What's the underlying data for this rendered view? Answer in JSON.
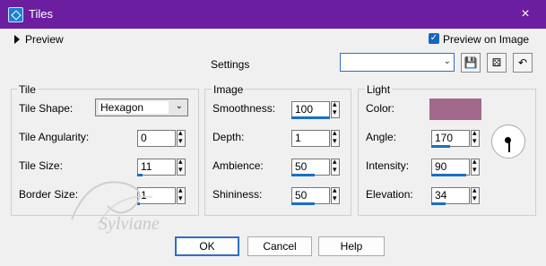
{
  "window": {
    "title": "Tiles",
    "close_glyph": "×"
  },
  "preview": {
    "label": "Preview",
    "checkbox_label": "Preview on Image",
    "checked": true
  },
  "settings": {
    "label": "Settings",
    "value": ""
  },
  "icons": [
    "app-icon",
    "expand-triangle-icon",
    "checkbox-check-icon",
    "dropdown-chevron-icon",
    "save-icon",
    "randomize-icon",
    "reset-icon"
  ],
  "tile": {
    "title": "Tile",
    "shape_label": "Tile Shape:",
    "shape_value": "Hexagon",
    "angularity_label": "Tile Angularity:",
    "angularity_value": "0",
    "size_label": "Tile Size:",
    "size_value": "11",
    "border_label": "Border Size:",
    "border_value": "1"
  },
  "image": {
    "title": "Image",
    "smoothness_label": "Smoothness:",
    "smoothness_value": "100",
    "depth_label": "Depth:",
    "depth_value": "1",
    "ambience_label": "Ambience:",
    "ambience_value": "50",
    "shininess_label": "Shininess:",
    "shininess_value": "50"
  },
  "light": {
    "title": "Light",
    "color_label": "Color:",
    "color_hex": "#a3698c",
    "angle_label": "Angle:",
    "angle_value": "170",
    "intensity_label": "Intensity:",
    "intensity_value": "90",
    "elevation_label": "Elevation:",
    "elevation_value": "34"
  },
  "buttons": {
    "ok": "OK",
    "cancel": "Cancel",
    "help": "Help"
  },
  "watermark": "Sylviane",
  "colors": {
    "titlebar": "#6b1fa0",
    "accent": "#1c6fc1"
  }
}
